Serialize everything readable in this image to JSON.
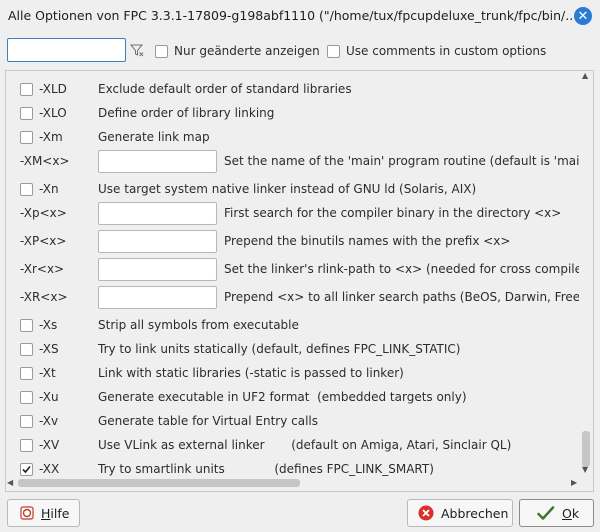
{
  "window": {
    "title": "Alle Optionen von FPC 3.3.1-17809-g198abf1110 (\"/home/tux/fpcupdeluxe_trunk/fpc/bin/...",
    "close_glyph": "✕"
  },
  "filter": {
    "value": "",
    "clear_glyph": "Y",
    "only_changed_label": "Nur geänderte anzeigen",
    "use_comments_label": "Use comments in custom options"
  },
  "options": [
    {
      "type": "check",
      "flag": "-XLD",
      "desc": "Exclude default order of standard libraries",
      "checked": false
    },
    {
      "type": "check",
      "flag": "-XLO",
      "desc": "Define order of library linking",
      "checked": false
    },
    {
      "type": "check",
      "flag": "-Xm",
      "desc": "Generate link map",
      "checked": false
    },
    {
      "type": "edit",
      "flag": "-XM<x>",
      "desc": "Set the name of the 'main' program routine (default is 'main')",
      "value": ""
    },
    {
      "type": "check",
      "flag": "-Xn",
      "desc": "Use target system native linker instead of GNU ld (Solaris, AIX)",
      "checked": false
    },
    {
      "type": "edit",
      "flag": "-Xp<x>",
      "desc": "First search for the compiler binary in the directory <x>",
      "value": ""
    },
    {
      "type": "edit",
      "flag": "-XP<x>",
      "desc": "Prepend the binutils names with the prefix <x>",
      "value": ""
    },
    {
      "type": "edit",
      "flag": "-Xr<x>",
      "desc": "Set the linker's rlink-path to <x> (needed for cross compile, see",
      "value": ""
    },
    {
      "type": "edit",
      "flag": "-XR<x>",
      "desc": "Prepend <x> to all linker search paths (BeOS, Darwin, FreeBSD,",
      "value": ""
    },
    {
      "type": "check",
      "flag": "-Xs",
      "desc": "Strip all symbols from executable",
      "checked": false
    },
    {
      "type": "check",
      "flag": "-XS",
      "desc": "Try to link units statically (default, defines FPC_LINK_STATIC)",
      "checked": false
    },
    {
      "type": "check",
      "flag": "-Xt",
      "desc": "Link with static libraries (-static is passed to linker)",
      "checked": false
    },
    {
      "type": "check",
      "flag": "-Xu",
      "desc": "Generate executable in UF2 format  (embedded targets only)",
      "checked": false
    },
    {
      "type": "check",
      "flag": "-Xv",
      "desc": "Generate table for Virtual Entry calls",
      "checked": false
    },
    {
      "type": "check",
      "flag": "-XV",
      "desc": "Use VLink as external linker       (default on Amiga, Atari, Sinclair QL)",
      "checked": false
    },
    {
      "type": "check",
      "flag": "-XX",
      "desc": "Try to smartlink units             (defines FPC_LINK_SMART)",
      "checked": true
    }
  ],
  "buttons": {
    "help_prefix": "H",
    "help_rest": "ilfe",
    "cancel": "Abbrechen",
    "ok_prefix": "O",
    "ok_rest": "k"
  },
  "colors": {
    "accent": "#2a7bd6",
    "cancel_icon": "#d9302b",
    "ok_icon": "#3a7d2c"
  }
}
